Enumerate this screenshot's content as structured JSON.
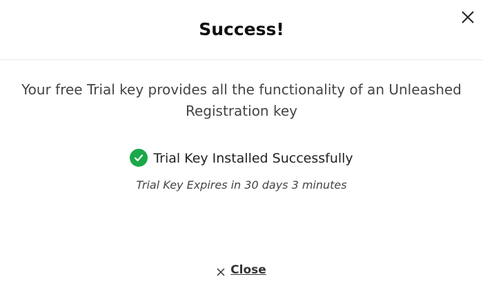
{
  "dialog": {
    "title": "Success!",
    "close_icon": "close-icon"
  },
  "main": {
    "description": "Your free Trial key provides all the functionality of an Unleashed Registration key",
    "status_text": "Trial Key Installed Successfully",
    "status_icon": "check-circle-icon",
    "status_color": "#1aa84a",
    "expiry_text": "Trial Key Expires in 30 days 3 minutes"
  },
  "footer": {
    "close_label": "Close",
    "close_icon": "x-icon"
  }
}
